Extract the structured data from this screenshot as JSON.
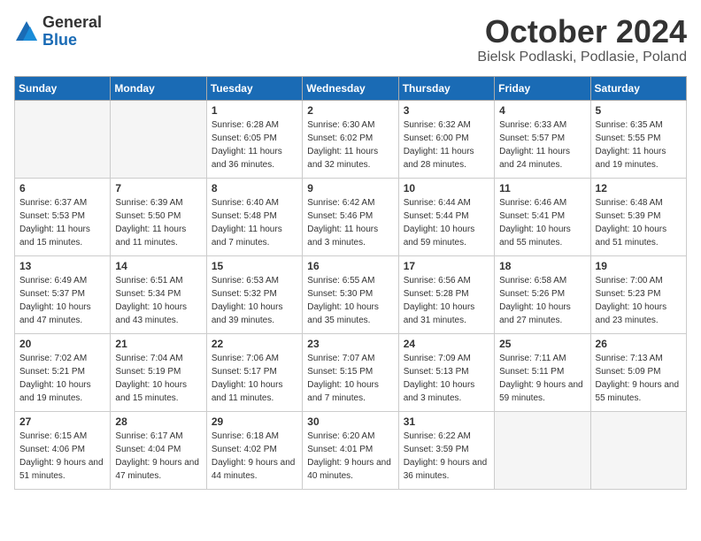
{
  "header": {
    "logo_general": "General",
    "logo_blue": "Blue",
    "month_title": "October 2024",
    "location": "Bielsk Podlaski, Podlasie, Poland"
  },
  "weekdays": [
    "Sunday",
    "Monday",
    "Tuesday",
    "Wednesday",
    "Thursday",
    "Friday",
    "Saturday"
  ],
  "weeks": [
    [
      {
        "day": "",
        "empty": true
      },
      {
        "day": "",
        "empty": true
      },
      {
        "day": "1",
        "sunrise": "6:28 AM",
        "sunset": "6:05 PM",
        "daylight": "11 hours and 36 minutes."
      },
      {
        "day": "2",
        "sunrise": "6:30 AM",
        "sunset": "6:02 PM",
        "daylight": "11 hours and 32 minutes."
      },
      {
        "day": "3",
        "sunrise": "6:32 AM",
        "sunset": "6:00 PM",
        "daylight": "11 hours and 28 minutes."
      },
      {
        "day": "4",
        "sunrise": "6:33 AM",
        "sunset": "5:57 PM",
        "daylight": "11 hours and 24 minutes."
      },
      {
        "day": "5",
        "sunrise": "6:35 AM",
        "sunset": "5:55 PM",
        "daylight": "11 hours and 19 minutes."
      }
    ],
    [
      {
        "day": "6",
        "sunrise": "6:37 AM",
        "sunset": "5:53 PM",
        "daylight": "11 hours and 15 minutes."
      },
      {
        "day": "7",
        "sunrise": "6:39 AM",
        "sunset": "5:50 PM",
        "daylight": "11 hours and 11 minutes."
      },
      {
        "day": "8",
        "sunrise": "6:40 AM",
        "sunset": "5:48 PM",
        "daylight": "11 hours and 7 minutes."
      },
      {
        "day": "9",
        "sunrise": "6:42 AM",
        "sunset": "5:46 PM",
        "daylight": "11 hours and 3 minutes."
      },
      {
        "day": "10",
        "sunrise": "6:44 AM",
        "sunset": "5:44 PM",
        "daylight": "10 hours and 59 minutes."
      },
      {
        "day": "11",
        "sunrise": "6:46 AM",
        "sunset": "5:41 PM",
        "daylight": "10 hours and 55 minutes."
      },
      {
        "day": "12",
        "sunrise": "6:48 AM",
        "sunset": "5:39 PM",
        "daylight": "10 hours and 51 minutes."
      }
    ],
    [
      {
        "day": "13",
        "sunrise": "6:49 AM",
        "sunset": "5:37 PM",
        "daylight": "10 hours and 47 minutes."
      },
      {
        "day": "14",
        "sunrise": "6:51 AM",
        "sunset": "5:34 PM",
        "daylight": "10 hours and 43 minutes."
      },
      {
        "day": "15",
        "sunrise": "6:53 AM",
        "sunset": "5:32 PM",
        "daylight": "10 hours and 39 minutes."
      },
      {
        "day": "16",
        "sunrise": "6:55 AM",
        "sunset": "5:30 PM",
        "daylight": "10 hours and 35 minutes."
      },
      {
        "day": "17",
        "sunrise": "6:56 AM",
        "sunset": "5:28 PM",
        "daylight": "10 hours and 31 minutes."
      },
      {
        "day": "18",
        "sunrise": "6:58 AM",
        "sunset": "5:26 PM",
        "daylight": "10 hours and 27 minutes."
      },
      {
        "day": "19",
        "sunrise": "7:00 AM",
        "sunset": "5:23 PM",
        "daylight": "10 hours and 23 minutes."
      }
    ],
    [
      {
        "day": "20",
        "sunrise": "7:02 AM",
        "sunset": "5:21 PM",
        "daylight": "10 hours and 19 minutes."
      },
      {
        "day": "21",
        "sunrise": "7:04 AM",
        "sunset": "5:19 PM",
        "daylight": "10 hours and 15 minutes."
      },
      {
        "day": "22",
        "sunrise": "7:06 AM",
        "sunset": "5:17 PM",
        "daylight": "10 hours and 11 minutes."
      },
      {
        "day": "23",
        "sunrise": "7:07 AM",
        "sunset": "5:15 PM",
        "daylight": "10 hours and 7 minutes."
      },
      {
        "day": "24",
        "sunrise": "7:09 AM",
        "sunset": "5:13 PM",
        "daylight": "10 hours and 3 minutes."
      },
      {
        "day": "25",
        "sunrise": "7:11 AM",
        "sunset": "5:11 PM",
        "daylight": "9 hours and 59 minutes."
      },
      {
        "day": "26",
        "sunrise": "7:13 AM",
        "sunset": "5:09 PM",
        "daylight": "9 hours and 55 minutes."
      }
    ],
    [
      {
        "day": "27",
        "sunrise": "6:15 AM",
        "sunset": "4:06 PM",
        "daylight": "9 hours and 51 minutes."
      },
      {
        "day": "28",
        "sunrise": "6:17 AM",
        "sunset": "4:04 PM",
        "daylight": "9 hours and 47 minutes."
      },
      {
        "day": "29",
        "sunrise": "6:18 AM",
        "sunset": "4:02 PM",
        "daylight": "9 hours and 44 minutes."
      },
      {
        "day": "30",
        "sunrise": "6:20 AM",
        "sunset": "4:01 PM",
        "daylight": "9 hours and 40 minutes."
      },
      {
        "day": "31",
        "sunrise": "6:22 AM",
        "sunset": "3:59 PM",
        "daylight": "9 hours and 36 minutes."
      },
      {
        "day": "",
        "empty": true
      },
      {
        "day": "",
        "empty": true
      }
    ]
  ]
}
